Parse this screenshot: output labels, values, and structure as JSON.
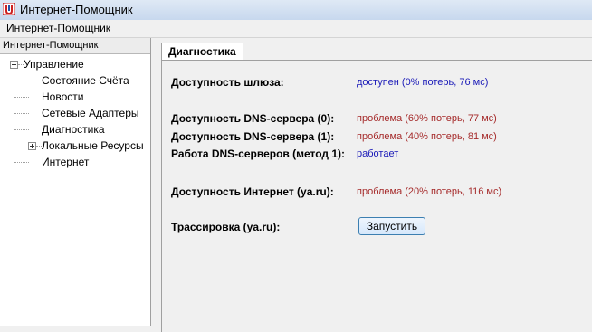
{
  "window": {
    "title": "Интернет-Помощник",
    "icon": "app-logo-icon"
  },
  "menubar": {
    "items": [
      {
        "label": "Интернет-Помощник"
      }
    ]
  },
  "sidebar": {
    "header": "Интернет-Помощник",
    "tree": {
      "root": {
        "label": "Управление",
        "expanded": true
      },
      "items": [
        {
          "label": "Состояние Счёта"
        },
        {
          "label": "Новости"
        },
        {
          "label": "Сетевые Адаптеры"
        },
        {
          "label": "Диагностика",
          "selected": true
        },
        {
          "label": "Локальные Ресурсы",
          "has_children": true
        },
        {
          "label": "Интернет"
        }
      ]
    }
  },
  "main": {
    "tab": "Диагностика",
    "rows": [
      {
        "label": "Доступность шлюза:",
        "value": "доступен (0% потерь, 76 мс)",
        "status": "ok"
      },
      {
        "label": "Доступность DNS-сервера (0):",
        "value": "проблема (60% потерь, 77 мс)",
        "status": "problem"
      },
      {
        "label": "Доступность DNS-сервера (1):",
        "value": "проблема (40% потерь, 81 мс)",
        "status": "problem"
      },
      {
        "label": "Работа DNS-серверов (метод 1):",
        "value": "работает",
        "status": "ok"
      },
      {
        "label": "Доступность Интернет (ya.ru):",
        "value": "проблема (20% потерь, 116 мс)",
        "status": "problem"
      },
      {
        "label": "Трассировка (ya.ru):"
      }
    ],
    "trace_button": "Запустить"
  },
  "colors": {
    "ok": "#1a1ab8",
    "problem": "#a52a2a"
  }
}
